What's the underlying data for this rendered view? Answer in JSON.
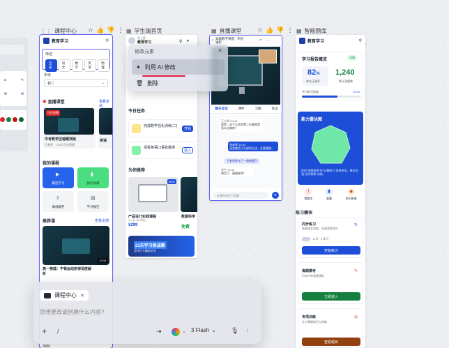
{
  "frames": [
    {
      "name": "课程中心"
    },
    {
      "name": "学生端首页"
    },
    {
      "name": "直播课堂"
    },
    {
      "name": "智能题库"
    }
  ],
  "course_center": {
    "brand": "教育学习",
    "filter_label": "筛选",
    "tabs": [
      "全部",
      "语文",
      "数学",
      "英语",
      "物理"
    ],
    "grade_label": "年级",
    "grade_value": "初二",
    "live_section": "直播课堂",
    "live_more": "查看全部",
    "live_badge": "正在直播",
    "live_title": "中考数学压轴题突破",
    "live_meta": "王老师 · 1.2k人正在观看",
    "live_title2": "英语",
    "my_courses": "我的课程",
    "tiles": [
      "最近学习",
      "我的收藏",
      "离线缓存",
      "学习报告"
    ],
    "recommend": "推荐课",
    "recommend_more": "查看全部",
    "video_time": "12:35",
    "rec_title": "高一物理：牛顿运动定律深度解析",
    "bottom_num": "3000"
  },
  "student_home": {
    "greeting": "早上好",
    "brand": "教育学习",
    "today": "今日任务",
    "tasks": [
      {
        "title": "完成数学强化训练(二)",
        "btn": "开始"
      },
      {
        "title": "观看英语口语直播课",
        "btn": "进入"
      }
    ],
    "recommend": "为你推荐",
    "product_badge": "NEW",
    "product_title": "产品设计实践课程",
    "product_rating": "4.9 (2.3k 评价)",
    "product_price": "¥299",
    "product_title2": "数据科学",
    "product_price2": "免费",
    "banner_title": "21天学习挑战赛",
    "banner_sub": "坚持打卡赢取好礼"
  },
  "live_room": {
    "title": "高级数学讲座：积分进阶",
    "tabs": [
      "聊天互动",
      "课件",
      "习题",
      "笔记"
    ],
    "msgs": [
      {
        "who": "王小明 10:43",
        "text": "老师，这个公式的第二行变换是怎么出来的？"
      },
      {
        "who": "张老师 10:44",
        "text": "这里使用了分部积分法，注意替换。"
      },
      {
        "who": "学生 10:46",
        "text": "明白了，谢谢老师！"
      }
    ],
    "system": "王老师发布了一道新题目",
    "input_placeholder": "发表你的学习见解..."
  },
  "question_bank": {
    "brand": "教育学习",
    "report_title": "学习报告概览",
    "report_badge": "本周",
    "accuracy": "82",
    "accuracy_unit": "%",
    "accuracy_label": "综合正确率",
    "count": "1,240",
    "count_label": "累计答题数",
    "progress_label": "今日练习进度",
    "progress_value": "12/20",
    "progress_fraction": 0.6,
    "radar_title": "能力雷达图",
    "radar_desc": "你的\"逻辑推理\"和\"计算能力\"表现突出，建议加强\"空间想象\"训练。",
    "quick": [
      "错题本",
      "收藏",
      "知识图谱"
    ],
    "practice_mode": "练习模块",
    "modules": [
      {
        "title": "同步练习",
        "sub": "紧跟课本进度，巩固课堂知识",
        "toggle": "12月 · 6 练习",
        "btn": "开始练习"
      },
      {
        "title": "真题模考",
        "sub": "历年中考真题模拟",
        "btn": "立即进入"
      },
      {
        "title": "专项训练",
        "sub": "针对薄弱知识点突破",
        "btn": "查看题目"
      }
    ],
    "colors": {
      "accent": "#1d4ed8",
      "green": "#22c55e",
      "radar": "#6ee7a8",
      "brown": "#92400e"
    }
  },
  "context_menu": {
    "title": "修改元素",
    "items": [
      {
        "label": "利用 AI 修改",
        "icon": "sparkle-icon"
      },
      {
        "label": "删除",
        "icon": "trash-icon"
      }
    ]
  },
  "prompt_box": {
    "chip": "课程中心",
    "placeholder": "您想更改或创建什么内容?",
    "model": "3 Flash"
  }
}
